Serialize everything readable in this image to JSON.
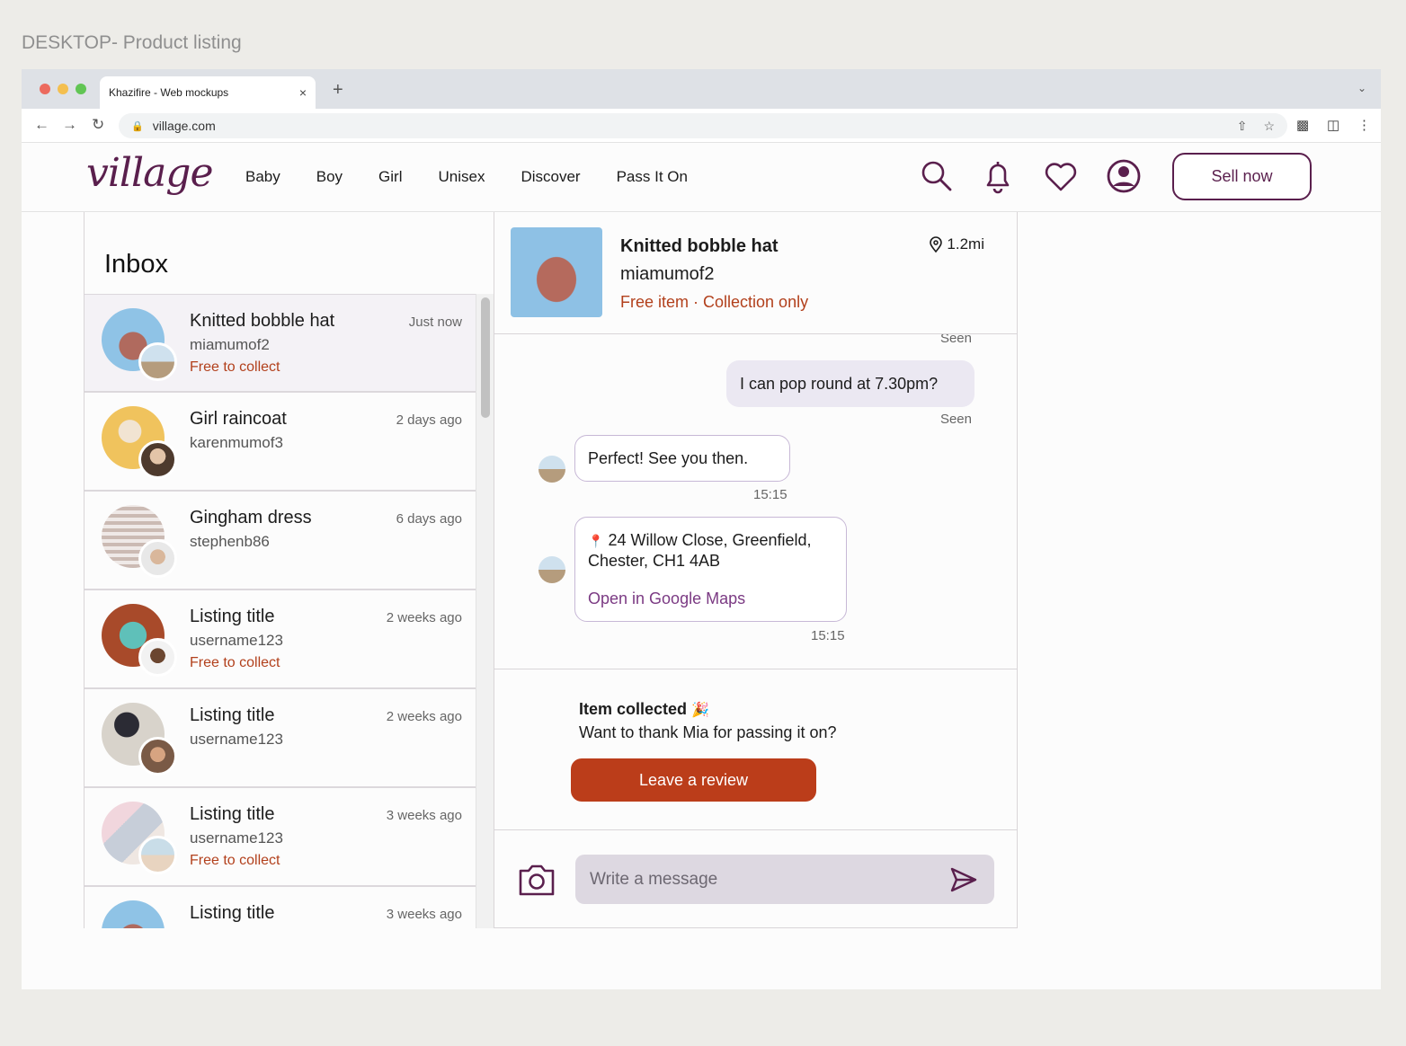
{
  "frame_label": "DESKTOP- Product listing",
  "browser": {
    "tab_title": "Khazifire - Web mockups",
    "tab_close": "×",
    "new_tab": "+",
    "url": "village.com"
  },
  "site": {
    "logo": "village",
    "nav": [
      "Baby",
      "Boy",
      "Girl",
      "Unisex",
      "Discover",
      "Pass It On"
    ],
    "sell_label": "Sell now"
  },
  "inbox": {
    "title": "Inbox",
    "conversations": [
      {
        "title": "Knitted bobble hat",
        "user": "miamumof2",
        "status": "Free to collect",
        "time": "Just now"
      },
      {
        "title": "Girl raincoat",
        "user": "karenmumof3",
        "status": "",
        "time": "2 days ago"
      },
      {
        "title": "Gingham dress",
        "user": "stephenb86",
        "status": "",
        "time": "6 days ago"
      },
      {
        "title": "Listing title",
        "user": "username123",
        "status": "Free to collect",
        "time": "2 weeks ago"
      },
      {
        "title": "Listing title",
        "user": "username123",
        "status": "",
        "time": "2 weeks ago"
      },
      {
        "title": "Listing title",
        "user": "username123",
        "status": "Free to collect",
        "time": "3 weeks ago"
      },
      {
        "title": "Listing title",
        "user": "",
        "status": "",
        "time": "3 weeks ago"
      }
    ]
  },
  "chat": {
    "item_title": "Knitted bobble hat",
    "user": "miamumof2",
    "status": "Free item · Collection only",
    "distance": "1.2mi",
    "messages": {
      "seen_top": "Seen",
      "outgoing": "I can pop round at 7.30pm?",
      "seen": "Seen",
      "incoming_1": "Perfect! See you then.",
      "time_1": "15:15",
      "address_pin": "📍",
      "address_line1": "24 Willow Close, Greenfield,",
      "address_line2": "Chester, CH1 4AB",
      "map_link": "Open in Google Maps",
      "time_2": "15:15"
    },
    "collected_title": "Item collected",
    "collected_emoji": "🎉",
    "collected_sub": "Want to thank Mia for passing it on?",
    "review_label": "Leave a review",
    "input_placeholder": "Write a message"
  },
  "colors": {
    "brand": "#5a1f4d",
    "accent": "#bb3d1a",
    "status": "#b2401c",
    "link": "#7b3a83"
  }
}
